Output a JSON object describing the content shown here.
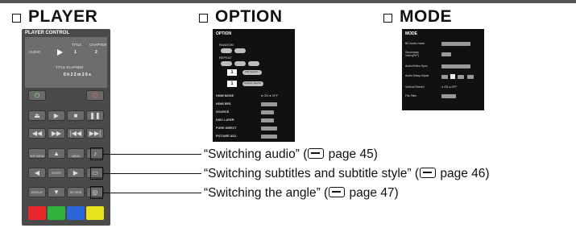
{
  "headings": {
    "player": "PLAYER",
    "option": "OPTION",
    "mode": "MODE"
  },
  "player_control": {
    "title": "PLAYER CONTROL",
    "display": {
      "audio_label": "AUDIO",
      "title_label": "TITLE",
      "chapter_label": "CHAPTER",
      "title_value": "1",
      "chapter_value": "2",
      "elapsed_label": "TITLE ELAPSED",
      "elapsed_value": "0 h 2 2 m 2 6 s"
    },
    "buttons": {
      "top_menu": "TOP MENU",
      "menu": "MENU",
      "enter": "ENTER",
      "display": "DISPLAY",
      "return": "RETURN"
    },
    "color_buttons": [
      "#e8262c",
      "#2fb23a",
      "#2b66d8",
      "#e9e21e"
    ]
  },
  "option_panel": {
    "title": "OPTION",
    "random": "RANDOM",
    "repeat": "REPEAT",
    "num1": "1",
    "num2": "1",
    "title_search": "Title Search",
    "chapter_search": "Chapter Search",
    "rows": [
      "HDMI MODE",
      "HDMI RES",
      "SOURCE",
      "DISC LAYER",
      "PURE DIRECT",
      "PICTURE ADJ."
    ],
    "radio_on": "ON",
    "radio_off": "OFF"
  },
  "mode_panel": {
    "title": "MODE",
    "rows": [
      "BD Audio mode",
      "Secondary Video(PIP)",
      "Audio/Video Sync",
      "Audio Delay Adjust",
      "Vertical Stretch",
      "File Filter"
    ],
    "radio_on": "ON",
    "radio_off": "OFF"
  },
  "captions": {
    "audio": "“Switching audio” (",
    "audio_page": " page 45)",
    "subtitle": "“Switching subtitles and subtitle style” (",
    "subtitle_page": " page 46)",
    "angle": "“Switching the angle” (",
    "angle_page": " page 47)"
  }
}
